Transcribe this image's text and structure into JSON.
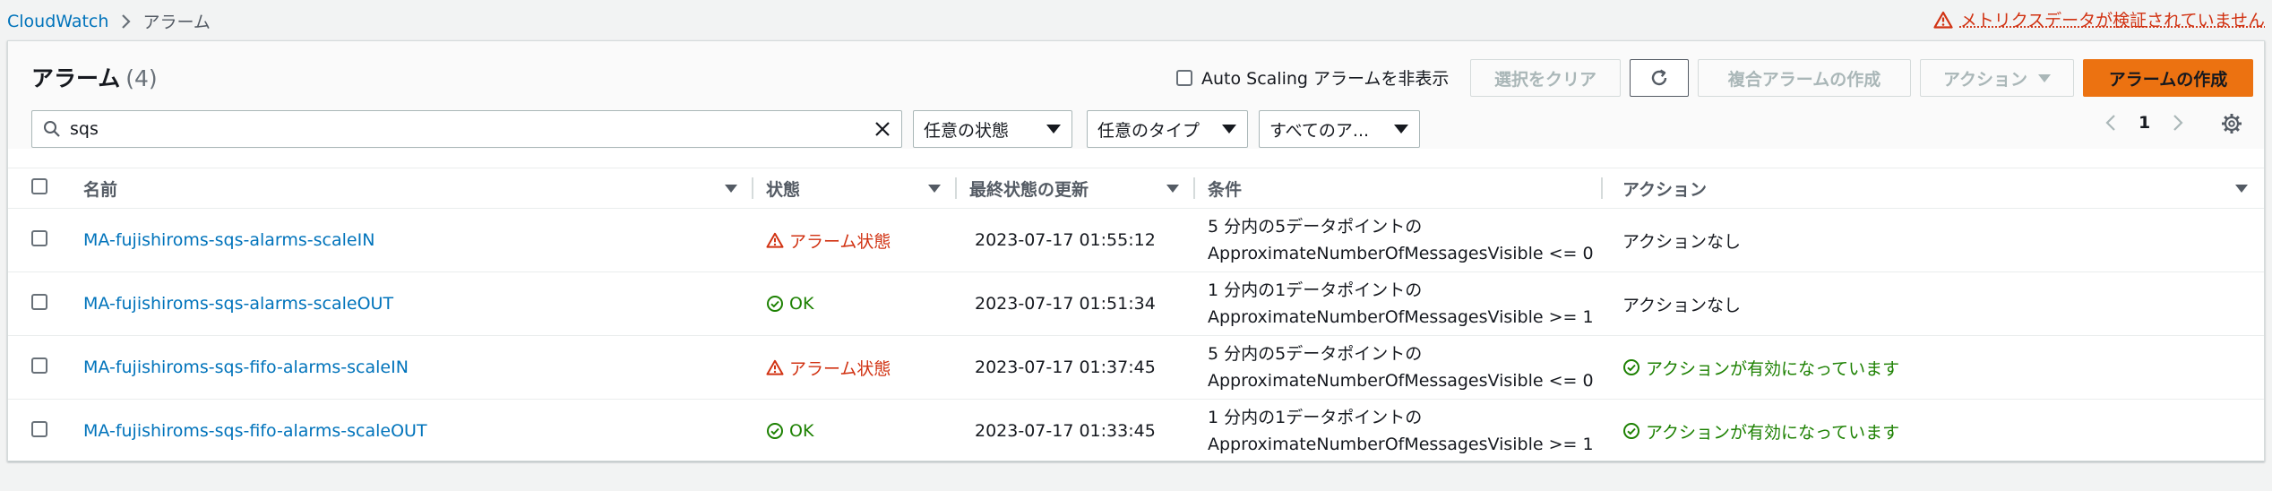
{
  "breadcrumb": {
    "root": "CloudWatch",
    "current": "アラーム"
  },
  "warning": "メトリクスデータが検証されていません",
  "header": {
    "title": "アラーム",
    "count": "(4)"
  },
  "autoscaling_label": "Auto Scaling アラームを非表示",
  "buttons": {
    "clear": "選択をクリア",
    "composite": "複合アラームの作成",
    "actions": "アクション",
    "create": "アラームの作成"
  },
  "search": {
    "value": "sqs"
  },
  "filters": {
    "state": "任意の状態",
    "type": "任意のタイプ",
    "all": "すべてのア..."
  },
  "pager": {
    "page": "1"
  },
  "columns": {
    "name": "名前",
    "state": "状態",
    "updated": "最終状態の更新",
    "condition": "条件",
    "actions": "アクション"
  },
  "rows": [
    {
      "name": "MA-fujishiroms-sqs-alarms-scaleIN",
      "state": "アラーム状態",
      "state_type": "alarm",
      "updated": "2023-07-17 01:55:12",
      "cond1": "5 分内の5データポイントの",
      "cond2": "ApproximateNumberOfMessagesVisible <= 0",
      "action": "アクションなし",
      "action_type": "none"
    },
    {
      "name": "MA-fujishiroms-sqs-alarms-scaleOUT",
      "state": "OK",
      "state_type": "ok",
      "updated": "2023-07-17 01:51:34",
      "cond1": "1 分内の1データポイントの",
      "cond2": "ApproximateNumberOfMessagesVisible >= 1",
      "action": "アクションなし",
      "action_type": "none"
    },
    {
      "name": "MA-fujishiroms-sqs-fifo-alarms-scaleIN",
      "state": "アラーム状態",
      "state_type": "alarm",
      "updated": "2023-07-17 01:37:45",
      "cond1": "5 分内の5データポイントの",
      "cond2": "ApproximateNumberOfMessagesVisible <= 0",
      "action": "アクションが有効になっています",
      "action_type": "enabled"
    },
    {
      "name": "MA-fujishiroms-sqs-fifo-alarms-scaleOUT",
      "state": "OK",
      "state_type": "ok",
      "updated": "2023-07-17 01:33:45",
      "cond1": "1 分内の1データポイントの",
      "cond2": "ApproximateNumberOfMessagesVisible >= 1",
      "action": "アクションが有効になっています",
      "action_type": "enabled"
    }
  ],
  "colors": {
    "link": "#0073bb",
    "alarm": "#d13212",
    "ok": "#1d8102",
    "primary": "#ec7211"
  },
  "icons": {
    "warning": "warning-triangle-icon",
    "ok": "check-circle-icon",
    "refresh": "refresh-icon",
    "search": "search-icon",
    "clear": "close-icon",
    "settings": "gear-icon"
  }
}
